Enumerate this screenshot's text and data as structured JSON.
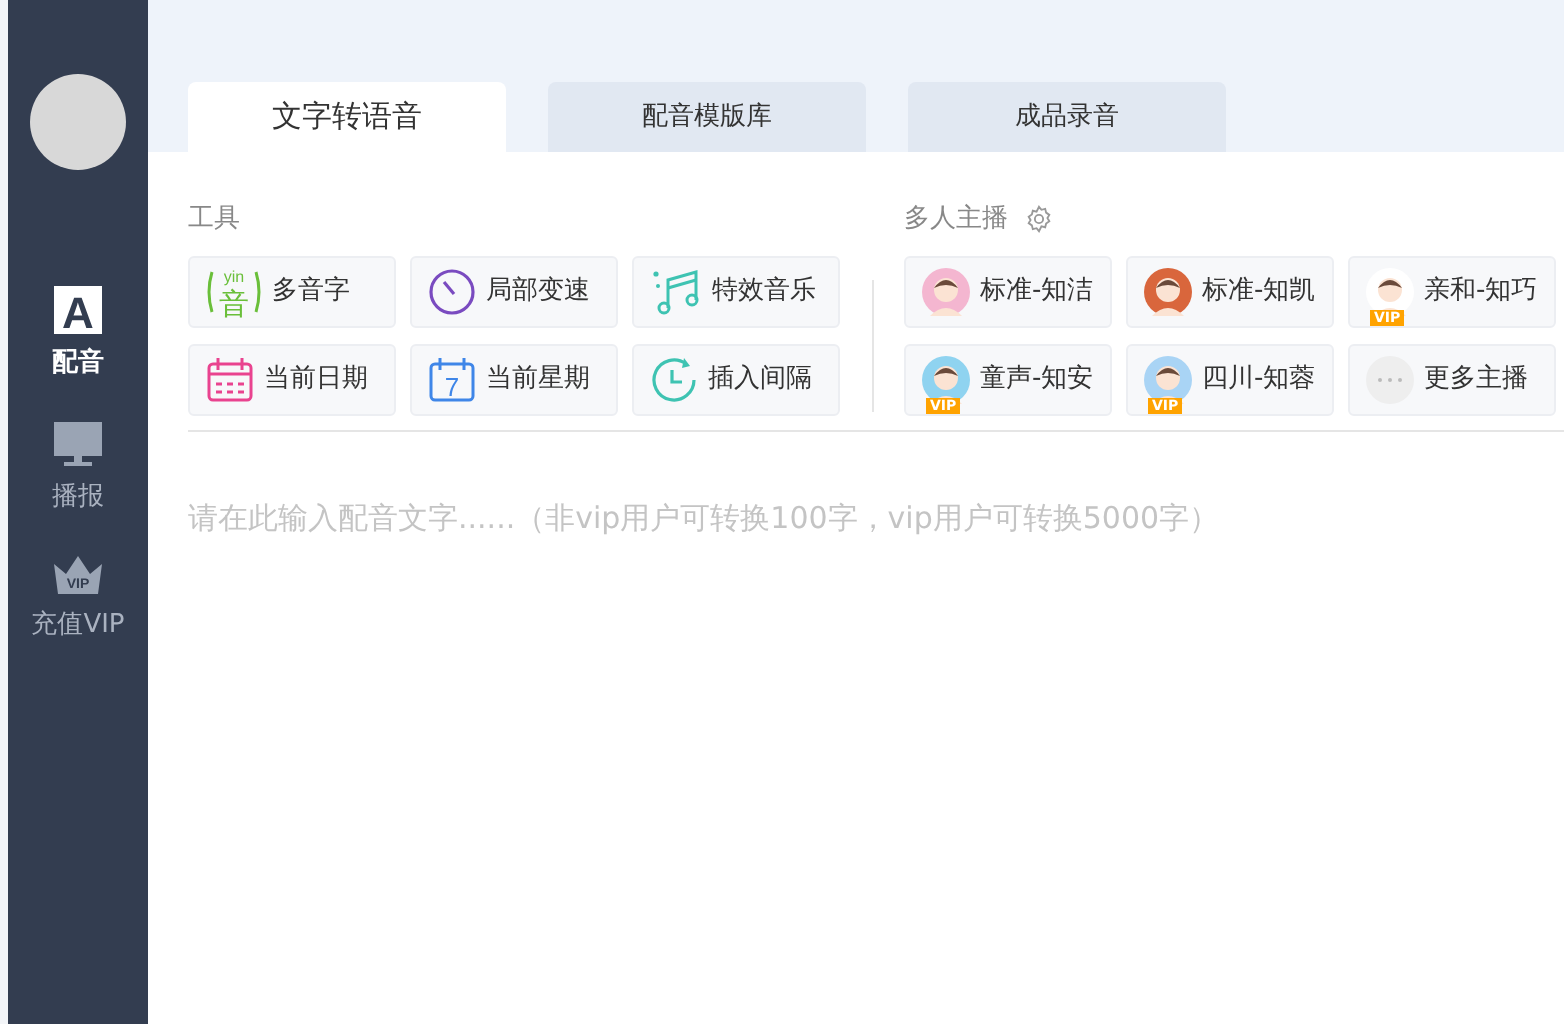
{
  "sidebar": {
    "items": [
      {
        "label": "配音",
        "icon_text": "A",
        "selected": true
      },
      {
        "label": "播报",
        "selected": false
      },
      {
        "label": "充值VIP",
        "icon_text": "VIP",
        "selected": false
      }
    ]
  },
  "tabs": [
    {
      "label": "文字转语音",
      "selected": true
    },
    {
      "label": "配音模版库",
      "selected": false
    },
    {
      "label": "成品录音",
      "selected": false
    }
  ],
  "tools": {
    "title": "工具",
    "items": [
      {
        "label": "多音字",
        "icon_text": "音",
        "icon_subtext": "yin"
      },
      {
        "label": "局部变速"
      },
      {
        "label": "特效音乐"
      },
      {
        "label": "当前日期"
      },
      {
        "label": "当前星期",
        "icon_text": "7"
      },
      {
        "label": "插入间隔"
      }
    ]
  },
  "hosts": {
    "title": "多人主播",
    "items": [
      {
        "label": "标准-知洁"
      },
      {
        "label": "标准-知凯"
      },
      {
        "label": "亲和-知巧",
        "badge": "VIP"
      },
      {
        "label": "童声-知安",
        "badge": "VIP"
      },
      {
        "label": "四川-知蓉",
        "badge": "VIP"
      },
      {
        "label": "更多主播",
        "kind": "more"
      }
    ]
  },
  "editor": {
    "placeholder": "请在此输入配音文字......（非vip用户可转换100字，vip用户可转换5000字）"
  }
}
